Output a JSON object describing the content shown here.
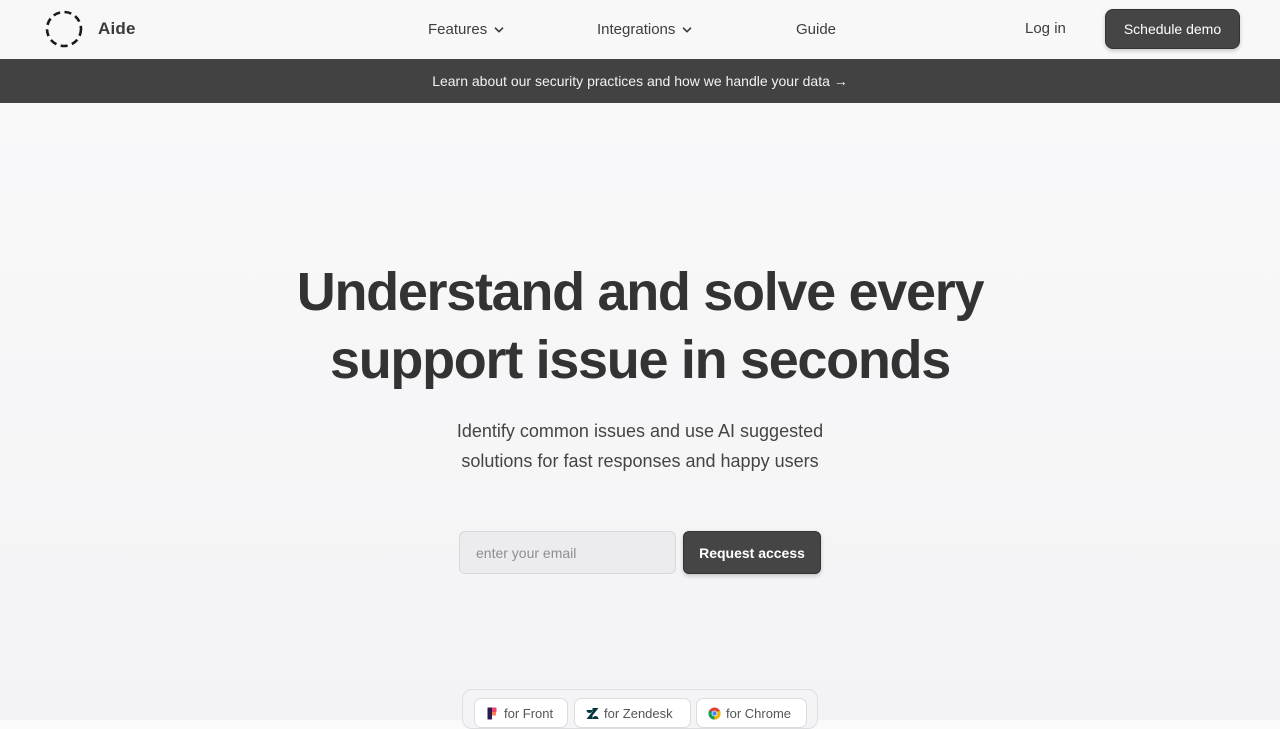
{
  "header": {
    "brand": "Aide",
    "nav": {
      "features": "Features",
      "integrations": "Integrations",
      "guide": "Guide"
    },
    "login_label": "Log in",
    "demo_label": "Schedule demo"
  },
  "banner": {
    "text": "Learn about our security practices and how we handle your data →"
  },
  "hero": {
    "title_line1": "Understand and solve every",
    "title_line2": "support issue in seconds",
    "subtitle_line1": "Identify common issues and use AI suggested",
    "subtitle_line2": "solutions for fast responses and happy users"
  },
  "signup": {
    "email_placeholder": "enter your email",
    "email_value": "",
    "request_label": "Request access"
  },
  "integrations": [
    {
      "label": "for Front",
      "icon": "front-logo-icon"
    },
    {
      "label": "for Zendesk",
      "icon": "zendesk-logo-icon"
    },
    {
      "label": "for Chrome",
      "icon": "chrome-logo-icon"
    }
  ],
  "colors": {
    "primary_button": "#454545",
    "banner_bg": "#424242",
    "text": "#333333",
    "page_bg": "#f7f7f8"
  }
}
